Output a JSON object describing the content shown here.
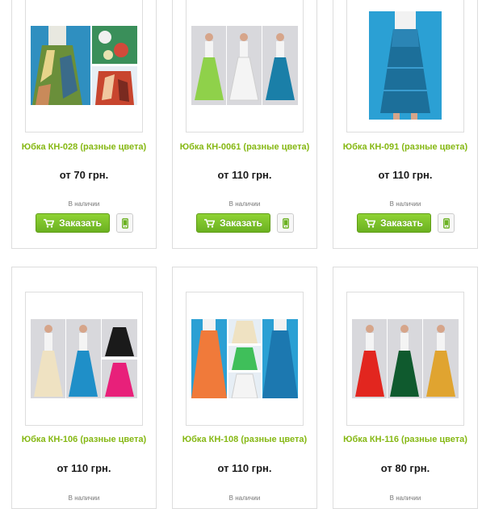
{
  "colors": {
    "accent_green": "#86b814",
    "button_green": "#7cc22a"
  },
  "products": [
    {
      "name": "Юбка КН-028 (разные цвета)",
      "price": "от 70 грн.",
      "availability": "В наличии",
      "order_label": "Заказать",
      "cart_icon": "cart-icon",
      "phone_icon": "mobile-phone-icon"
    },
    {
      "name": "Юбка КН-0061 (разные цвета)",
      "price": "от 110 грн.",
      "availability": "В наличии",
      "order_label": "Заказать",
      "cart_icon": "cart-icon",
      "phone_icon": "mobile-phone-icon"
    },
    {
      "name": "Юбка КН-091 (разные цвета)",
      "price": "от 110 грн.",
      "availability": "В наличии",
      "order_label": "Заказать",
      "cart_icon": "cart-icon",
      "phone_icon": "mobile-phone-icon"
    },
    {
      "name": "Юбка КН-106 (разные цвета)",
      "price": "от 110 грн.",
      "availability": "В наличии"
    },
    {
      "name": "Юбка КН-108 (разные цвета)",
      "price": "от 110 грн.",
      "availability": "В наличии"
    },
    {
      "name": "Юбка КН-116 (разные цвета)",
      "price": "от 80 грн.",
      "availability": "В наличии"
    }
  ]
}
